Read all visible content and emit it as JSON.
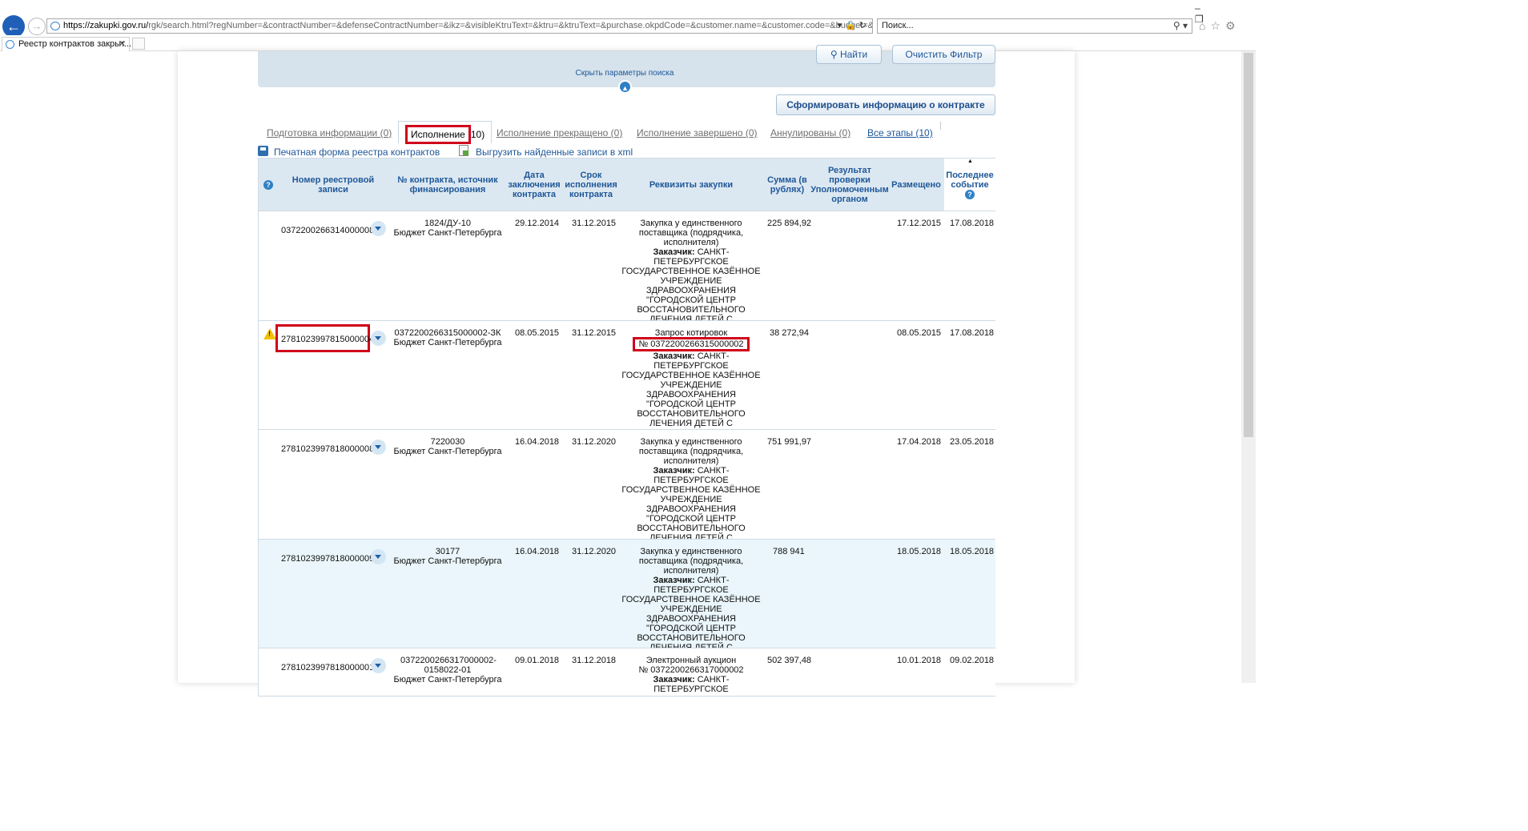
{
  "browser": {
    "url_domain": "https://zakupki.gov.ru/",
    "url_rest": "rgk/search.html?regNumber=&contractNumber=&defenseContractNumber=&ikz=&visibleKtruText=&ktru=&ktruText=&purchase.okpdCode=&customer.name=&customer.code=&budget=&_bud",
    "search_placeholder": "Поиск...",
    "tab_title": "Реестр контрактов закрыт...",
    "tab_close": "✕"
  },
  "filter": {
    "find_label": "Найти",
    "clear_label": "Очистить Фильтр",
    "hide_params": "Скрыть параметры поиска"
  },
  "form_info_label": "Сформировать информацию о контракте",
  "stages": [
    {
      "label": "Подготовка информации (0)"
    },
    {
      "label": "Исполнение",
      "count": "10)"
    },
    {
      "label": "Исполнение прекращено (0)"
    },
    {
      "label": "Исполнение завершено (0)"
    },
    {
      "label": "Аннулированы (0)"
    },
    {
      "label": "Все этапы (10)"
    }
  ],
  "links": {
    "print": "Печатная форма реестра контрактов",
    "xml": "Выгрузить найденные записи в xml"
  },
  "table": {
    "headers": {
      "help": "?",
      "reg_number": "Номер реестровой записи",
      "contract_number": "№ контракта, источник финансирования",
      "date": "Дата заключения контракта",
      "term": "Срок исполнения контракта",
      "requisites": "Реквизиты закупки",
      "sum": "Сумма (в рублях)",
      "check": "Результат проверки Уполномоченным органом",
      "posted": "Размещено",
      "last_event": "Последнее событие"
    },
    "rows": [
      {
        "reg": "0372200266314000008",
        "contract": "1824/ДУ-10",
        "source": "Бюджет Санкт-Петербурга",
        "date": "29.12.2014",
        "term": "31.12.2015",
        "req_method": "Закупка у единственного поставщика (подрядчика, исполнителя)",
        "req_number": "",
        "customer_label": "Заказчик:",
        "customer": "САНКТ-ПЕТЕРБУРГСКОЕ ГОСУДАРСТВЕННОЕ КАЗЁННОЕ УЧРЕЖДЕНИЕ ЗДРАВООХРАНЕНИЯ \"ГОРОДСКОЙ ЦЕНТР ВОССТАНОВИТЕЛЬНОГО ЛЕЧЕНИЯ ДЕТЕЙ С ПСИХОНЕВРОЛОГИЧЕСКИМИ НАРУШЕНИЯМИ\"",
        "sum": "225 894,92",
        "posted": "17.12.2015",
        "last_event": "17.08.2018"
      },
      {
        "reg": "2781023997815000004",
        "contract": "0372200266315000002-ЗК",
        "source": "Бюджет Санкт-Петербурга",
        "date": "08.05.2015",
        "term": "31.12.2015",
        "req_method": "Запрос котировок",
        "req_number": "№ 0372200266315000002",
        "customer_label": "Заказчик:",
        "customer": "САНКТ-ПЕТЕРБУРГСКОЕ ГОСУДАРСТВЕННОЕ КАЗЁННОЕ УЧРЕЖДЕНИЕ ЗДРАВООХРАНЕНИЯ \"ГОРОДСКОЙ ЦЕНТР ВОССТАНОВИТЕЛЬНОГО ЛЕЧЕНИЯ ДЕТЕЙ С ПСИХОНЕВРОЛОГИЧЕСКИМИ НАРУШЕНИЯМИ\"",
        "sum": "38 272,94",
        "posted": "08.05.2015",
        "last_event": "17.08.2018"
      },
      {
        "reg": "2781023997818000008",
        "contract": "7220030",
        "source": "Бюджет Санкт-Петербурга",
        "date": "16.04.2018",
        "term": "31.12.2020",
        "req_method": "Закупка у единственного поставщика (подрядчика, исполнителя)",
        "req_number": "",
        "customer_label": "Заказчик:",
        "customer": "САНКТ-ПЕТЕРБУРГСКОЕ ГОСУДАРСТВЕННОЕ КАЗЁННОЕ УЧРЕЖДЕНИЕ ЗДРАВООХРАНЕНИЯ \"ГОРОДСКОЙ ЦЕНТР ВОССТАНОВИТЕЛЬНОГО ЛЕЧЕНИЯ ДЕТЕЙ С ПСИХОНЕВРОЛОГИЧЕСКИМИ НАРУШЕНИЯМИ\"",
        "sum": "751 991,97",
        "posted": "17.04.2018",
        "last_event": "23.05.2018"
      },
      {
        "reg": "2781023997818000009",
        "contract": "30177",
        "source": "Бюджет Санкт-Петербурга",
        "date": "16.04.2018",
        "term": "31.12.2020",
        "req_method": "Закупка у единственного поставщика (подрядчика, исполнителя)",
        "req_number": "",
        "customer_label": "Заказчик:",
        "customer": "САНКТ-ПЕТЕРБУРГСКОЕ ГОСУДАРСТВЕННОЕ КАЗЁННОЕ УЧРЕЖДЕНИЕ ЗДРАВООХРАНЕНИЯ \"ГОРОДСКОЙ ЦЕНТР ВОССТАНОВИТЕЛЬНОГО ЛЕЧЕНИЯ ДЕТЕЙ С ПСИХОНЕВРОЛОГИЧЕСКИМИ НАРУШЕНИЯМИ\"",
        "sum": "788 941",
        "posted": "18.05.2018",
        "last_event": "18.05.2018"
      },
      {
        "reg": "2781023997818000001",
        "contract": "0372200266317000002-0158022-01",
        "source": "Бюджет Санкт-Петербурга",
        "date": "09.01.2018",
        "term": "31.12.2018",
        "req_method": "Электронный аукцион",
        "req_number": "№ 0372200266317000002",
        "customer_label": "Заказчик:",
        "customer": "САНКТ-ПЕТЕРБУРГСКОЕ",
        "sum": "502 397,48",
        "posted": "10.01.2018",
        "last_event": "09.02.2018"
      }
    ]
  }
}
